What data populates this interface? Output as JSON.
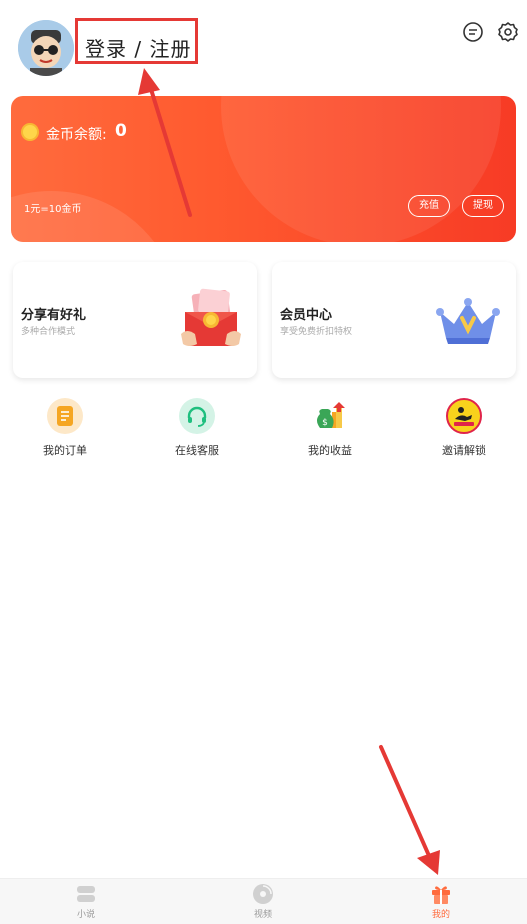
{
  "header": {
    "login_label": "登录 / 注册",
    "avatar_icon": "avatar-cartoon",
    "message_icon": "message-icon",
    "settings_icon": "gear-icon"
  },
  "coin_card": {
    "label": "金币余额:",
    "value": "0",
    "rate": "1元=10金币",
    "recharge_label": "充值",
    "withdraw_label": "提现",
    "colors": {
      "start": "#ff6b3d",
      "end": "#f73b25"
    }
  },
  "features": [
    {
      "title": "分享有好礼",
      "subtitle": "多种合作模式",
      "icon": "red-envelope-icon"
    },
    {
      "title": "会员中心",
      "subtitle": "享受免费折扣特权",
      "icon": "crown-icon"
    }
  ],
  "quick_actions": [
    {
      "label": "我的订单",
      "icon": "order-icon"
    },
    {
      "label": "在线客服",
      "icon": "headset-icon"
    },
    {
      "label": "我的收益",
      "icon": "money-bag-icon"
    },
    {
      "label": "邀请解锁",
      "icon": "invite-icon"
    }
  ],
  "bottom_nav": [
    {
      "label": "小说",
      "icon": "book-icon",
      "active": false
    },
    {
      "label": "视频",
      "icon": "disc-icon",
      "active": false
    },
    {
      "label": "我的",
      "icon": "gift-icon",
      "active": true
    }
  ],
  "accent_color": "#ff6b3d",
  "annotation_color": "#e53935"
}
